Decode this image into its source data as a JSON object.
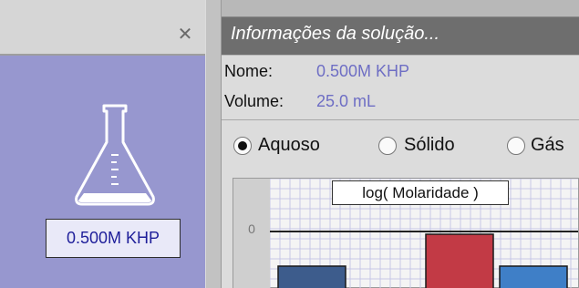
{
  "left_panel": {
    "close_icon": "close-icon",
    "flask_icon": "erlenmeyer-flask-icon",
    "solution_label": "0.500M KHP",
    "background": "#9797cf"
  },
  "right_panel": {
    "title": "Informações da solução...",
    "name_label": "Nome:",
    "name_value": "0.500M KHP",
    "volume_label": "Volume:",
    "volume_value": "25.0 mL",
    "phases": [
      {
        "label": "Aquoso",
        "selected": true
      },
      {
        "label": "Sólido",
        "selected": false
      },
      {
        "label": "Gás",
        "selected": false
      }
    ]
  },
  "chart_data": {
    "type": "bar",
    "title": "log( Molaridade )",
    "y_tick_labels": [
      "0"
    ],
    "bar_colors": [
      "#3d5c8c",
      "#c23a45",
      "#3f7fc7"
    ]
  }
}
